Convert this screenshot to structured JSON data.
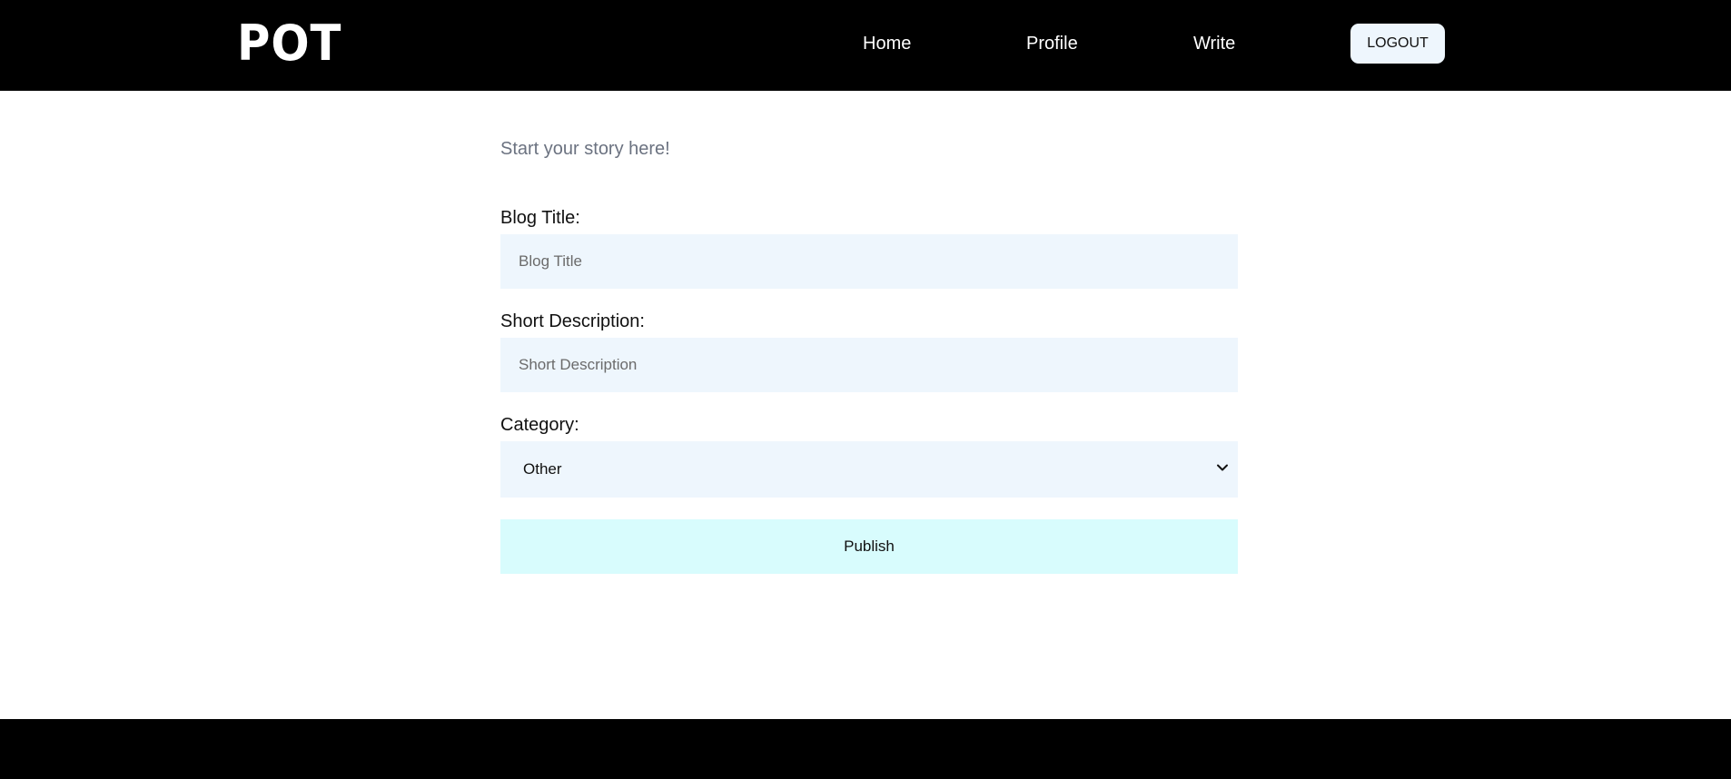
{
  "brand": {
    "logo_text": "POT"
  },
  "nav": {
    "links": [
      {
        "label": "Home"
      },
      {
        "label": "Profile"
      },
      {
        "label": "Write"
      }
    ],
    "logout_label": "LOGOUT"
  },
  "editor": {
    "intro": "Start your story here!",
    "blog_title": {
      "label": "Blog Title:",
      "placeholder": "Blog Title",
      "value": ""
    },
    "short_description": {
      "label": "Short Description:",
      "placeholder": "Short Description",
      "value": ""
    },
    "category": {
      "label": "Category:",
      "selected": "Other"
    },
    "publish_label": "Publish"
  },
  "colors": {
    "navbar_bg": "#000000",
    "input_bg": "#eef6fd",
    "publish_bg": "#d8fcfd",
    "intro_text": "#6b7280"
  }
}
